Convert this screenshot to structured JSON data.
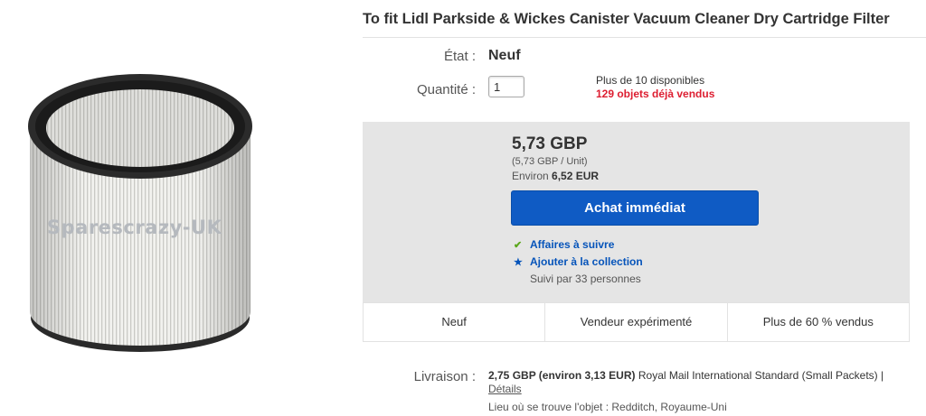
{
  "product": {
    "title": "To fit Lidl Parkside & Wickes Canister Vacuum Cleaner Dry Cartridge Filter",
    "watermark": "Sparescrazy-UK"
  },
  "condition": {
    "label": "État :",
    "value": "Neuf"
  },
  "quantity": {
    "label": "Quantité :",
    "value": "1",
    "available": "Plus de 10 disponibles",
    "sold": "129 objets déjà vendus"
  },
  "pricing": {
    "price": "5,73 GBP",
    "unit_price": "(5,73 GBP / Unit)",
    "approx_prefix": "Environ",
    "approx_value": "6,52 EUR",
    "buy_button": "Achat immédiat",
    "watch_label": "Affaires à suivre",
    "collection_label": "Ajouter à la collection",
    "followers": "Suivi par 33 personnes"
  },
  "badges": [
    "Neuf",
    "Vendeur expérimenté",
    "Plus de 60 % vendus"
  ],
  "shipping": {
    "label": "Livraison :",
    "cost": "2,75 GBP (environ 3,13 EUR)",
    "service": "Royal Mail International Standard (Small Packets) |",
    "details_link": "Détails",
    "location": "Lieu où se trouve l'objet : Redditch, Royaume-Uni"
  },
  "colors": {
    "buy_button": "#0f5bc4",
    "link": "#0654ba",
    "sold_red": "#dd1e31",
    "price_box": "#e5e5e5",
    "check_green": "#5ba71b"
  }
}
